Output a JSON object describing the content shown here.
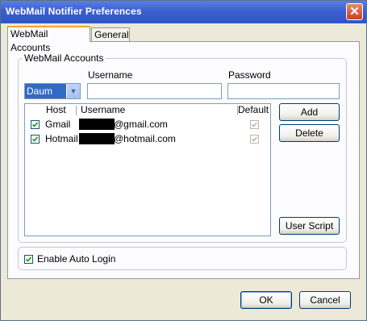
{
  "window": {
    "title": "WebMail Notifier Preferences",
    "close_glyph": "✕"
  },
  "tabs": [
    {
      "label": "WebMail Accounts",
      "active": true
    },
    {
      "label": "General",
      "active": false
    }
  ],
  "accounts_group": {
    "legend": "WebMail Accounts",
    "host_select": {
      "value": "Daum"
    },
    "username_label": "Username",
    "password_label": "Password",
    "username_value": "",
    "password_value": ""
  },
  "table": {
    "headers": {
      "host": "Host",
      "username": "Username",
      "default": "Default"
    },
    "rows": [
      {
        "enabled": true,
        "host": "Gmail",
        "username_visible": "@gmail.com",
        "default": true
      },
      {
        "enabled": true,
        "host": "Hotmail",
        "username_visible": "@hotmail.com",
        "default": true
      }
    ]
  },
  "buttons": {
    "add": "Add",
    "delete": "Delete",
    "user_script": "User Script",
    "ok": "OK",
    "cancel": "Cancel"
  },
  "auto_login": {
    "label": "Enable Auto Login",
    "checked": true
  },
  "icons": {
    "close": "close-icon",
    "dropdown": "chevron-down-icon",
    "check": "checkmark-icon"
  },
  "colors": {
    "titlebar": "#2f55c8",
    "tab_accent": "#f0a431",
    "selection": "#316ac5",
    "checkmark": "#21a121"
  }
}
